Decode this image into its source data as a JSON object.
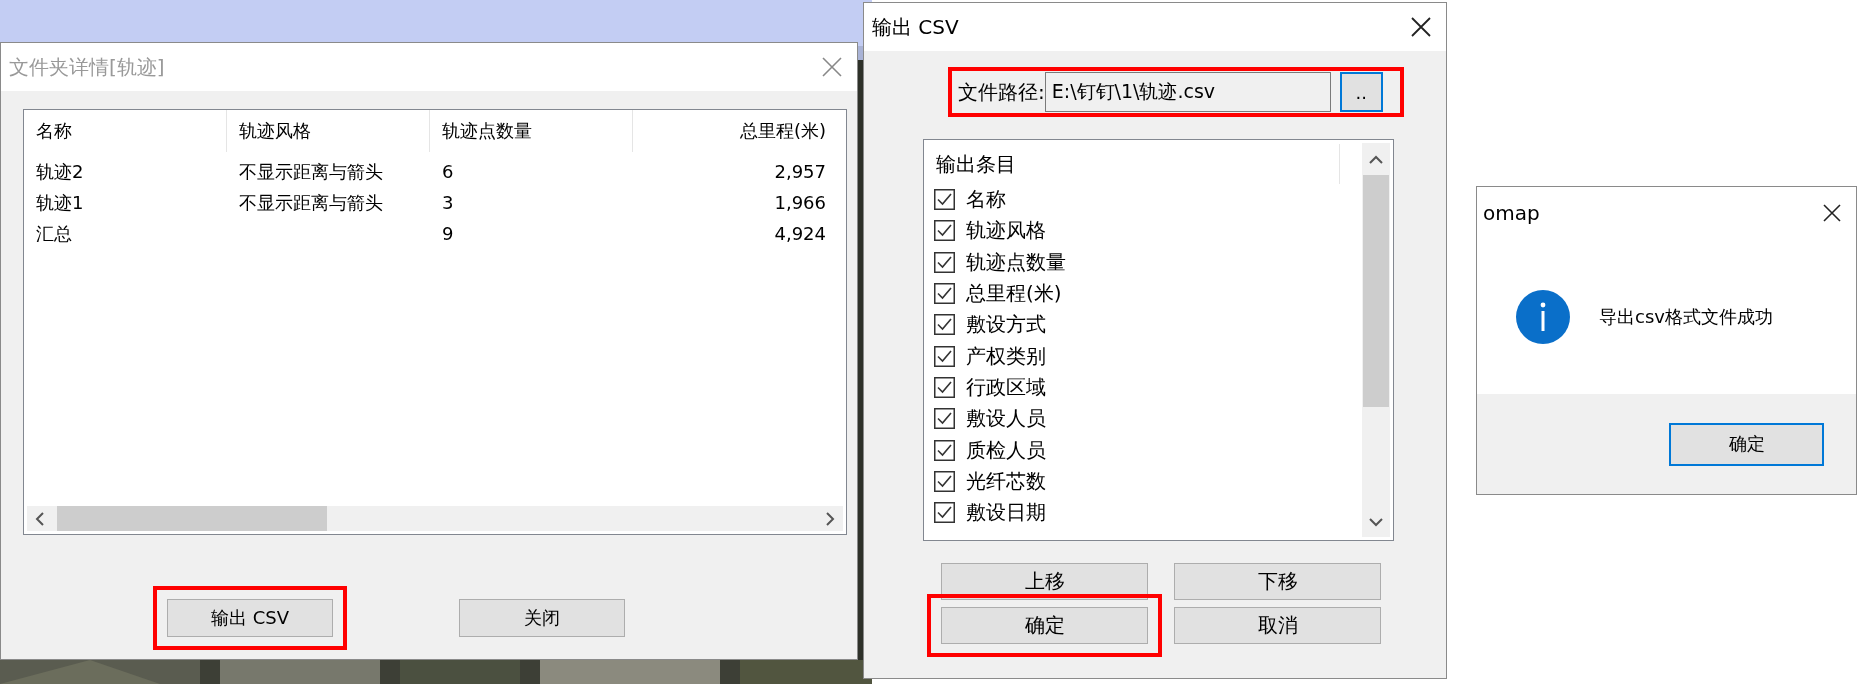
{
  "folder_dialog": {
    "title": "文件夹详情[轨迹]",
    "columns": [
      "名称",
      "轨迹风格",
      "轨迹点数量",
      "总里程(米)"
    ],
    "rows": [
      [
        "轨迹2",
        "不显示距离与箭头",
        "6",
        "2,957"
      ],
      [
        "轨迹1",
        "不显示距离与箭头",
        "3",
        "1,966"
      ],
      [
        "汇总",
        "",
        "9",
        "4,924"
      ]
    ],
    "buttons": [
      {
        "label": "输出 CSV",
        "highlighted": true
      },
      {
        "label": "关闭",
        "highlighted": false
      }
    ]
  },
  "export_dialog": {
    "title": "输出 CSV",
    "path_label": "文件路径:",
    "path_value": "E:\\钉钉\\1\\轨迹.csv",
    "path_highlighted": true,
    "browse_button": {
      "label": "..",
      "focused": true
    },
    "list_header": "输出条目",
    "items": [
      {
        "label": "名称",
        "checked": true
      },
      {
        "label": "轨迹风格",
        "checked": true
      },
      {
        "label": "轨迹点数量",
        "checked": true
      },
      {
        "label": "总里程(米)",
        "checked": true
      },
      {
        "label": "敷设方式",
        "checked": true
      },
      {
        "label": "产权类别",
        "checked": true
      },
      {
        "label": "行政区域",
        "checked": true
      },
      {
        "label": "敷设人员",
        "checked": true
      },
      {
        "label": "质检人员",
        "checked": true
      },
      {
        "label": "光纤芯数",
        "checked": true
      },
      {
        "label": "敷设日期",
        "checked": true
      }
    ],
    "buttons": [
      {
        "label": "上移",
        "highlighted": false
      },
      {
        "label": "下移",
        "highlighted": false
      },
      {
        "label": "确定",
        "highlighted": true
      },
      {
        "label": "取消",
        "highlighted": false
      }
    ]
  },
  "message_box": {
    "title": "omap",
    "message": "导出csv格式文件成功",
    "button": {
      "label": "确定",
      "focused": true
    }
  }
}
